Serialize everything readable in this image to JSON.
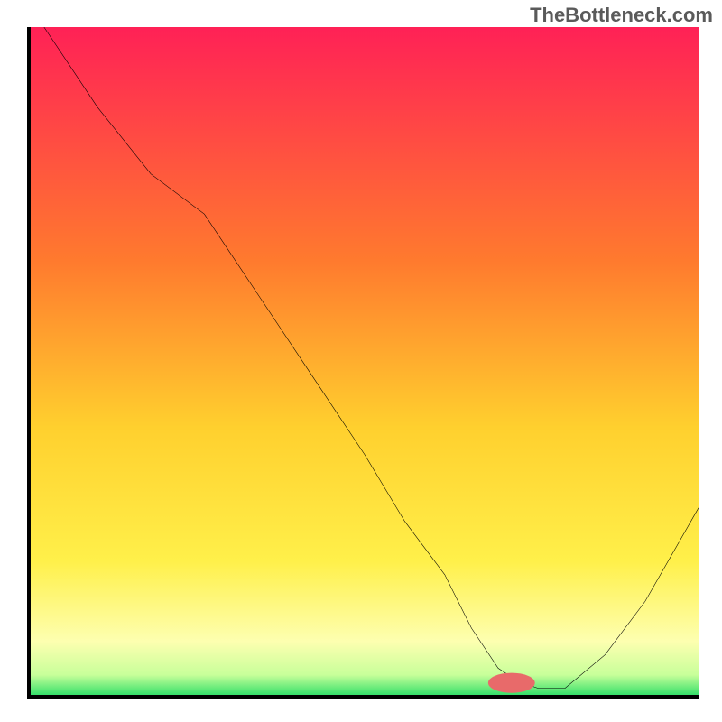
{
  "watermark": "TheBottleneck.com",
  "chart_data": {
    "type": "line",
    "title": "",
    "xlabel": "",
    "ylabel": "",
    "xlim": [
      0,
      100
    ],
    "ylim": [
      0,
      100
    ],
    "series": [
      {
        "name": "bottleneck-curve",
        "x": [
          2,
          10,
          18,
          26,
          34,
          42,
          50,
          56,
          62,
          66,
          70,
          73,
          76,
          80,
          86,
          92,
          100
        ],
        "values": [
          100,
          88,
          78,
          72,
          60,
          48,
          36,
          26,
          18,
          10,
          4,
          2,
          1,
          1,
          6,
          14,
          28
        ]
      }
    ],
    "marker": {
      "x": 72,
      "y": 1.8,
      "color": "#e86a6a",
      "rx": 3.5,
      "ry": 1.5
    },
    "gradient_stops": [
      {
        "offset": 0,
        "color": "#ff2156"
      },
      {
        "offset": 35,
        "color": "#ff7a2e"
      },
      {
        "offset": 60,
        "color": "#ffd02e"
      },
      {
        "offset": 80,
        "color": "#fff04a"
      },
      {
        "offset": 92,
        "color": "#fdffb0"
      },
      {
        "offset": 97,
        "color": "#c8ff9a"
      },
      {
        "offset": 100,
        "color": "#35e06a"
      }
    ]
  }
}
